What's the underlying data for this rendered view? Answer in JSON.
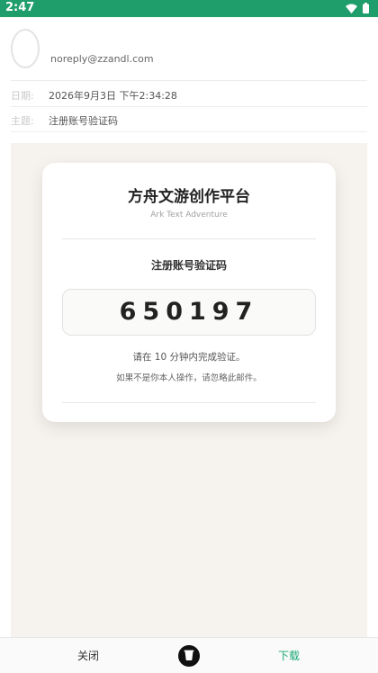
{
  "status_bar": {
    "time": "2:47",
    "background": "#1f9d6b"
  },
  "email": {
    "from": "noreply@zzandl.com",
    "date_label": "日期:",
    "date_value": "2026年9月3日 下午2:34:28",
    "subject_label": "主题:",
    "subject_value": "注册账号验证码"
  },
  "card": {
    "title": "方舟文游创作平台",
    "subtitle": "Ark Text Adventure",
    "heading": "注册账号验证码",
    "code": "650197",
    "note_primary": "请在 10 分钟内完成验证。",
    "note_secondary": "如果不是你本人操作，请忽略此邮件。"
  },
  "bottom_bar": {
    "close_label": "关闭",
    "download_label": "下载",
    "delete_icon": "trash-icon",
    "accent_color": "#1aa874"
  }
}
